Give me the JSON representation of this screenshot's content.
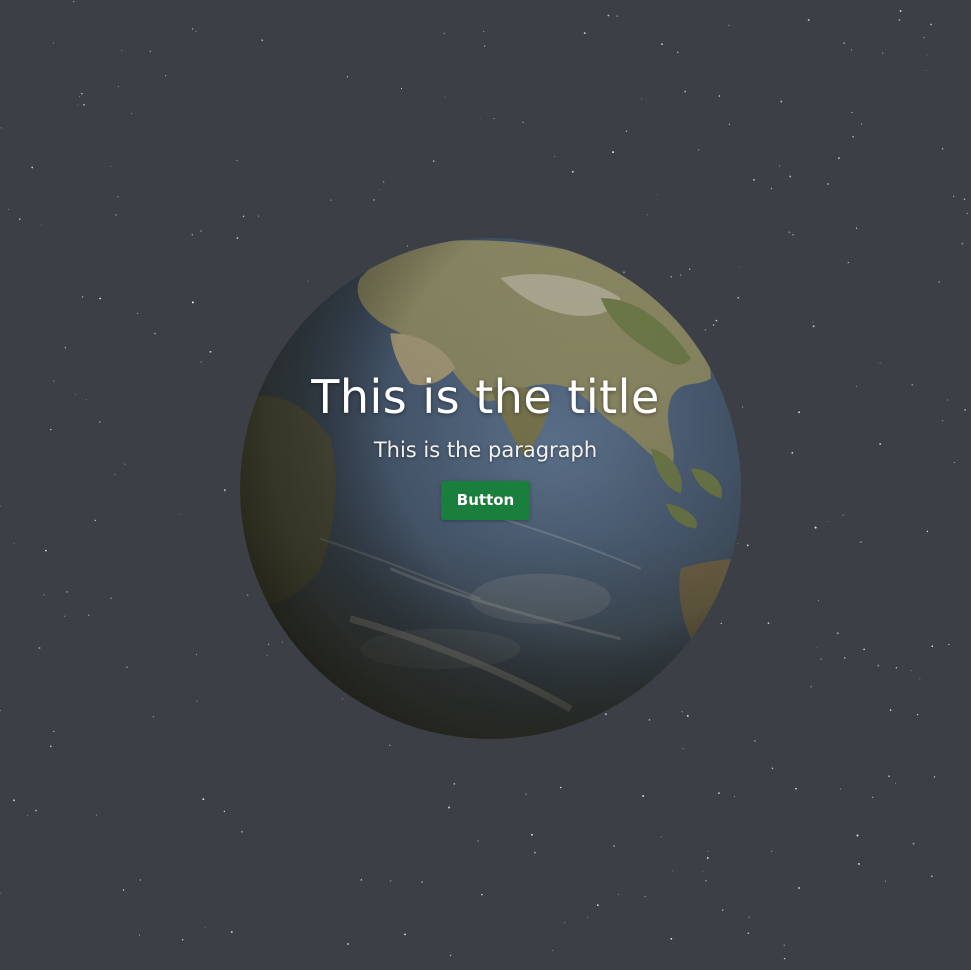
{
  "hero": {
    "title": "This is the title",
    "paragraph": "This is the paragraph",
    "button_label": "Button"
  },
  "colors": {
    "background": "#3c4046",
    "button": "#1a7f3c",
    "text": "#ffffff"
  }
}
